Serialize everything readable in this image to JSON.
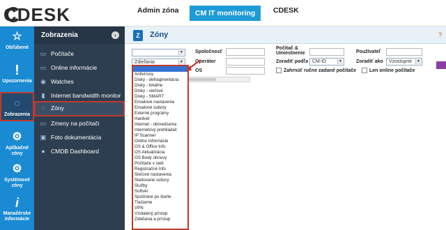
{
  "app": {
    "logo": "CDESK"
  },
  "top_nav": [
    {
      "label": "Admin zóna",
      "active": false
    },
    {
      "label": "CM IT monitoring",
      "active": true
    },
    {
      "label": "CDESK",
      "active": false
    }
  ],
  "left_nav": [
    {
      "label": "Obľúbené",
      "icon": "star-gear-icon"
    },
    {
      "label": "Upozornenia",
      "icon": "exclamation-icon"
    },
    {
      "label": "Zobrazenia",
      "icon": "circle-icon",
      "active": true
    },
    {
      "label": "Aplikačné zóny",
      "icon": "app-gear-icon"
    },
    {
      "label": "Systémové zóny",
      "icon": "system-gear-icon"
    },
    {
      "label": "Manažérske informácie",
      "icon": "info-icon"
    }
  ],
  "submenu": {
    "title": "Zobrazenia",
    "collapse_symbol": "‹",
    "items": [
      {
        "label": "Počítače",
        "icon": "monitor-icon"
      },
      {
        "label": "Online informácie",
        "icon": "monitor-icon"
      },
      {
        "label": "Watches",
        "icon": "eye-icon"
      },
      {
        "label": "Internet bandwidth monitor",
        "icon": "chart-icon"
      },
      {
        "label": "Zóny",
        "icon": "zone-icon",
        "active": true
      },
      {
        "label": "Zmeny na počítači",
        "icon": "monitor-icon"
      },
      {
        "label": "Foto dokumentácia",
        "icon": "camera-icon"
      },
      {
        "label": "CMDB Dashboard",
        "icon": "dashboard-icon"
      }
    ]
  },
  "page": {
    "title": "Zóny",
    "help": "?",
    "title_icon_letter": "Z"
  },
  "filters": {
    "zone_select": "",
    "zone_type": "Zdieľania",
    "spolocnost_label": "Spoločnosť",
    "operator_label": "Operátor",
    "os_label": "OS",
    "pocitac_label": "Počítač & Umiestnenie",
    "pouzivatel_label": "Používateľ",
    "zoradit_podla_label": "Zoradiť podľa",
    "zoradit_podla_value": "CM-ID",
    "zoradit_ako_label": "Zoradiť ako",
    "zoradit_ako_value": "Vzostupne",
    "zahrnut_label": "Zahrnúť ručne zadané počítače",
    "online_label": "Len online počítače"
  },
  "dropdown_options": [
    "Antivírusy",
    "Disky - defragmentácia",
    "Disky - lokálne",
    "Disky - sieťové",
    "Disky - SMART",
    "Emailové nastavenia",
    "Emailové súbory",
    "Externé programy",
    "Hardvér",
    "Internet - obmedzenia",
    "Internetový prehliadač",
    "IP Scanner",
    "Online Informácie",
    "OS & Office Info",
    "OS Aktualizácia",
    "OS Body obnovy",
    "Počítače v sieti",
    "Registračné Info",
    "Sieťové nastavenia",
    "Sledované súbory",
    "Služby",
    "Softvér",
    "Spúšťané po štarte",
    "Tlačiarne",
    "VPN",
    "Vzdialený prístup",
    "Zdieľania a prístup"
  ],
  "colors": {
    "left_nav": "#1a8ad3",
    "submenu": "#2d3e50",
    "highlight": "#c0392b",
    "top_active": "#1e9bd7"
  }
}
